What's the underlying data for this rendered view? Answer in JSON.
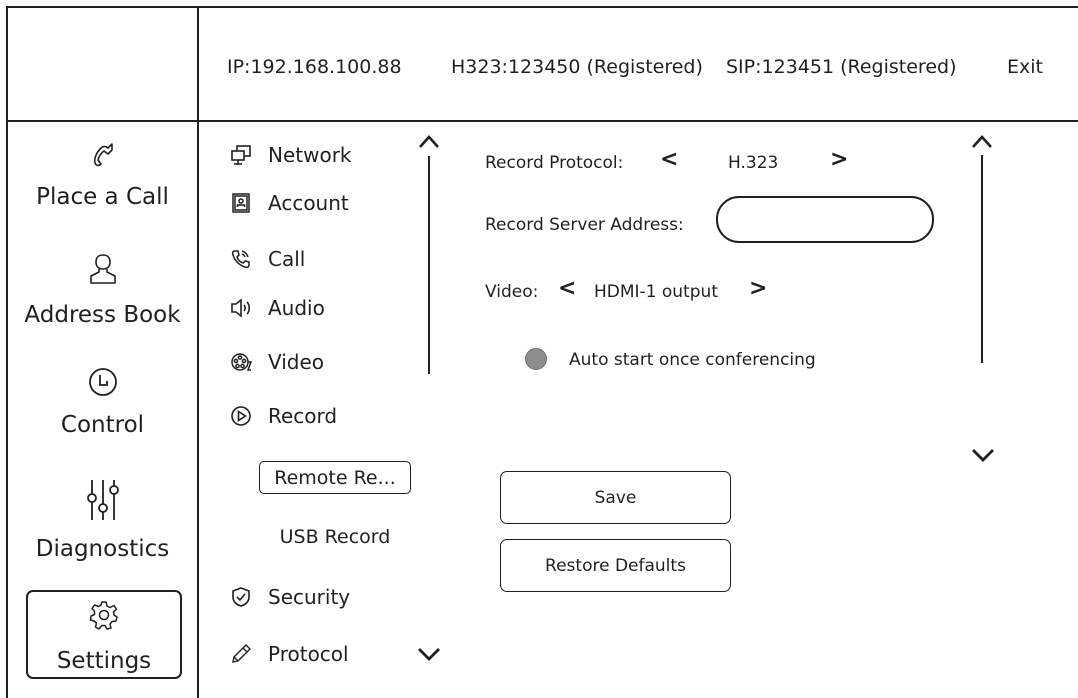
{
  "header": {
    "ip": "IP:192.168.100.88",
    "h323": "H323:123450 (Registered)",
    "sip": "SIP:123451 (Registered)",
    "exit": "Exit"
  },
  "nav": {
    "items": [
      {
        "label": "Place a Call",
        "icon": "phone-icon"
      },
      {
        "label": "Address Book",
        "icon": "person-icon"
      },
      {
        "label": "Control",
        "icon": "clock-icon"
      },
      {
        "label": "Diagnostics",
        "icon": "sliders-icon"
      },
      {
        "label": "Settings",
        "icon": "gear-icon",
        "active": true
      }
    ]
  },
  "submenu": {
    "items": [
      {
        "label": "Network",
        "icon": "network-icon"
      },
      {
        "label": "Account",
        "icon": "account-icon"
      },
      {
        "label": "Call",
        "icon": "call-icon"
      },
      {
        "label": "Audio",
        "icon": "speaker-icon"
      },
      {
        "label": "Video",
        "icon": "film-reel-icon"
      },
      {
        "label": "Record",
        "icon": "play-circle-icon"
      },
      {
        "label": "Security",
        "icon": "shield-icon"
      },
      {
        "label": "Protocol",
        "icon": "pencil-icon"
      }
    ],
    "record_children": [
      "Remote Re...",
      "USB Record"
    ]
  },
  "record": {
    "protocol_label": "Record Protocol:",
    "protocol_value": "H.323",
    "server_label": "Record Server Address:",
    "server_value": "",
    "video_label": "Video:",
    "video_value": "HDMI-1 output",
    "auto_start_label": "Auto start once conferencing",
    "auto_start_checked": false,
    "save_label": "Save",
    "restore_label": "Restore Defaults"
  },
  "colors": {
    "line": "#231f20",
    "radio_fill": "#8d8d8d"
  }
}
